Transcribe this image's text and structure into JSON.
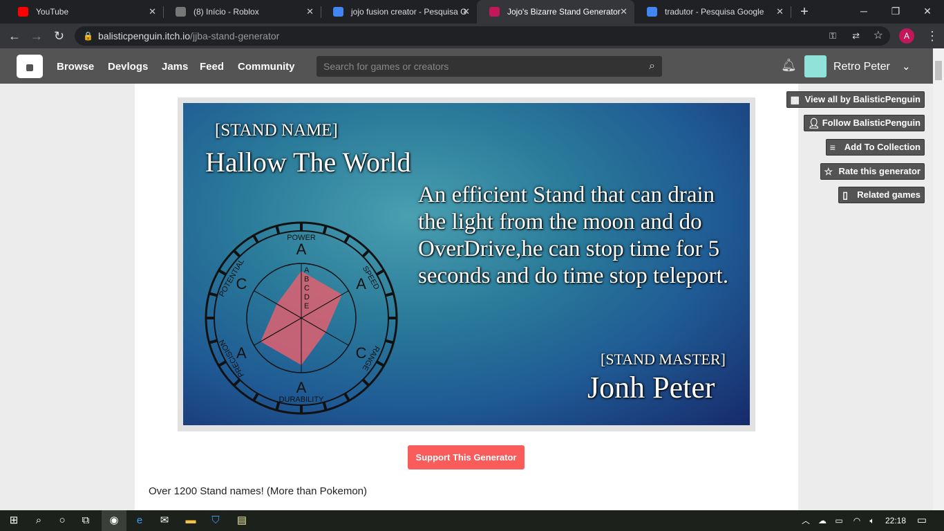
{
  "browser": {
    "tabs": [
      {
        "title": "YouTube",
        "color": "#ff0000"
      },
      {
        "title": "(8) Início - Roblox",
        "color": "#777777"
      },
      {
        "title": "jojo fusion creator - Pesquisa G",
        "color": "#4285f4"
      },
      {
        "title": "Jojo's Bizarre Stand Generator",
        "color": "#c2185b"
      },
      {
        "title": "tradutor - Pesquisa Google",
        "color": "#4285f4"
      }
    ],
    "url_host": "balisticpenguin.itch.io",
    "url_path": "/jjba-stand-generator",
    "profile_initial": "A"
  },
  "nav": {
    "links": [
      "Browse",
      "Devlogs",
      "Jams",
      "Feed",
      "Community"
    ],
    "search_placeholder": "Search for games or creators",
    "user": "Retro Peter"
  },
  "sidebar": [
    "View all by BalisticPenguin",
    "Follow BalisticPenguin",
    "Add To Collection",
    "Rate this generator",
    "Related games"
  ],
  "stand": {
    "name_label": "[STAND NAME]",
    "name": "Hallow The World",
    "description": "An efficient Stand that can drain the light from the moon and do OverDrive,he can stop time for 5 seconds and do time stop teleport.",
    "master_label": "[STAND MASTER]",
    "master": "Jonh Peter",
    "stats": [
      {
        "name": "POWER",
        "grade": "A"
      },
      {
        "name": "SPEED",
        "grade": "A"
      },
      {
        "name": "RANGE",
        "grade": "C"
      },
      {
        "name": "DURABILITY",
        "grade": "A"
      },
      {
        "name": "PRECISION",
        "grade": "A"
      },
      {
        "name": "POTENTIAL",
        "grade": "C"
      }
    ],
    "scale": [
      "A",
      "B",
      "C",
      "D",
      "E"
    ],
    "fill_color": "#e06070"
  },
  "main": {
    "support_label": "Support This Generator",
    "description": "Over 1200 Stand names! (More than Pokemon)"
  },
  "taskbar": {
    "time": "22:18"
  }
}
